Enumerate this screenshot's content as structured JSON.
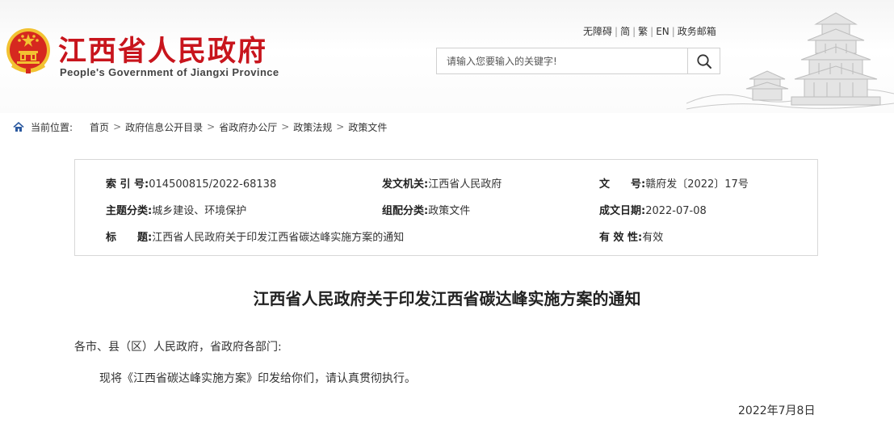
{
  "header": {
    "site_name_cn": "江西省人民政府",
    "site_name_en": "People's Government of Jiangxi Province",
    "top_links": [
      "无障碍",
      "简",
      "繁",
      "EN",
      "政务邮箱"
    ],
    "search_placeholder": "请输入您要输入的关键字!"
  },
  "breadcrumb": {
    "label": "当前位置:",
    "items": [
      "首页",
      "政府信息公开目录",
      "省政府办公厅",
      "政策法规",
      "政策文件"
    ],
    "arrow": ">"
  },
  "meta": {
    "index_label": "索 引 号:",
    "index_value": "014500815/2022-68138",
    "issuer_label": "发文机关:",
    "issuer_value": "江西省人民政府",
    "docno_label": "文　　号:",
    "docno_value": "赣府发〔2022〕17号",
    "topic_label": "主题分类:",
    "topic_value": "城乡建设、环境保护",
    "category_label": "组配分类:",
    "category_value": "政策文件",
    "date_label": "成文日期:",
    "date_value": "2022-07-08",
    "title_label": "标　　题:",
    "title_value": "江西省人民政府关于印发江西省碳达峰实施方案的通知",
    "validity_label": "有 效 性:",
    "validity_value": "有效"
  },
  "article": {
    "title": "江西省人民政府关于印发江西省碳达峰实施方案的通知",
    "salutation": "各市、县（区）人民政府，省政府各部门:",
    "body": "现将《江西省碳达峰实施方案》印发给你们，请认真贯彻执行。",
    "date": "2022年7月8日"
  },
  "colors": {
    "brand_red": "#c8151d",
    "emblem_gold": "#f2c232",
    "emblem_red": "#d6281f"
  }
}
